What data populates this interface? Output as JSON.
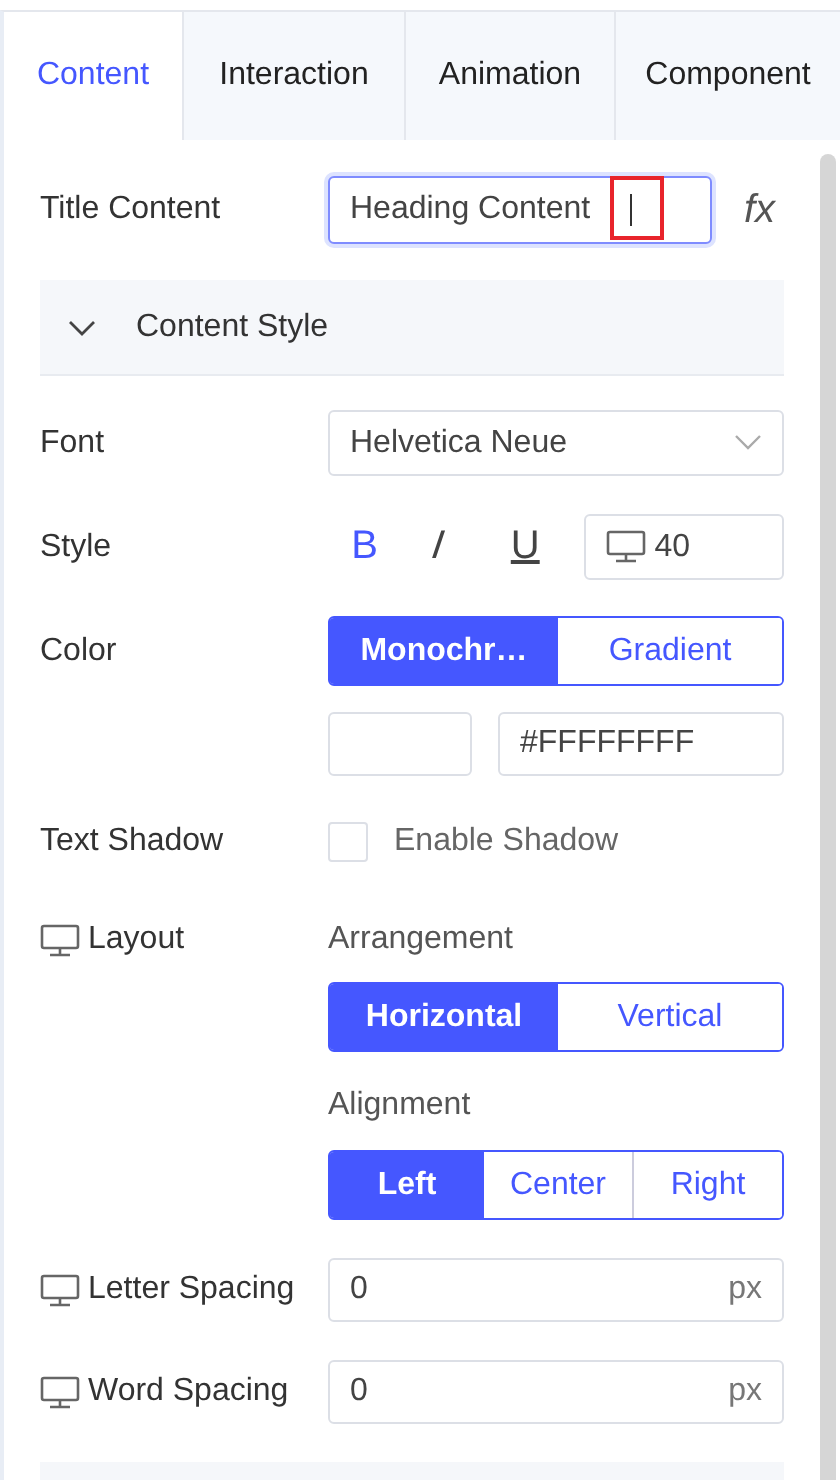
{
  "tabs": [
    {
      "label": "Content",
      "selected": true
    },
    {
      "label": "Interaction",
      "selected": false
    },
    {
      "label": "Animation",
      "selected": false
    },
    {
      "label": "Component",
      "selected": false
    }
  ],
  "title_content": {
    "label": "Title Content",
    "value": "Heading Content",
    "focused": true,
    "highlighted": true,
    "fx": "fx"
  },
  "section": {
    "title": "Content Style",
    "expanded": true
  },
  "font": {
    "label": "Font",
    "value": "Helvetica Neue"
  },
  "style": {
    "label": "Style",
    "buttons": [
      {
        "text": "B",
        "kind": "bold",
        "selected": true
      },
      {
        "text": "I",
        "kind": "italic",
        "selected": false
      },
      {
        "text": "U",
        "kind": "underline",
        "selected": false
      }
    ],
    "size": "40"
  },
  "color": {
    "label": "Color",
    "modes": [
      {
        "label": "Monochr…",
        "selected": true
      },
      {
        "label": "Gradient",
        "selected": false
      }
    ],
    "hex": "#FFFFFFFF"
  },
  "text_shadow": {
    "label": "Text Shadow",
    "option": "Enable Shadow",
    "checked": false
  },
  "layout": {
    "label": "Layout",
    "groups": [
      {
        "title": "Arrangement",
        "options": [
          {
            "label": "Horizontal",
            "selected": true
          },
          {
            "label": "Vertical",
            "selected": false
          }
        ]
      },
      {
        "title": "Alignment",
        "options": [
          {
            "label": "Left",
            "selected": true
          },
          {
            "label": "Center",
            "selected": false
          },
          {
            "label": "Right",
            "selected": false
          }
        ]
      }
    ]
  },
  "spacing": [
    {
      "label": "Letter Spacing",
      "value": "0",
      "unit": "px"
    },
    {
      "label": "Word Spacing",
      "value": "0",
      "unit": "px"
    }
  ]
}
